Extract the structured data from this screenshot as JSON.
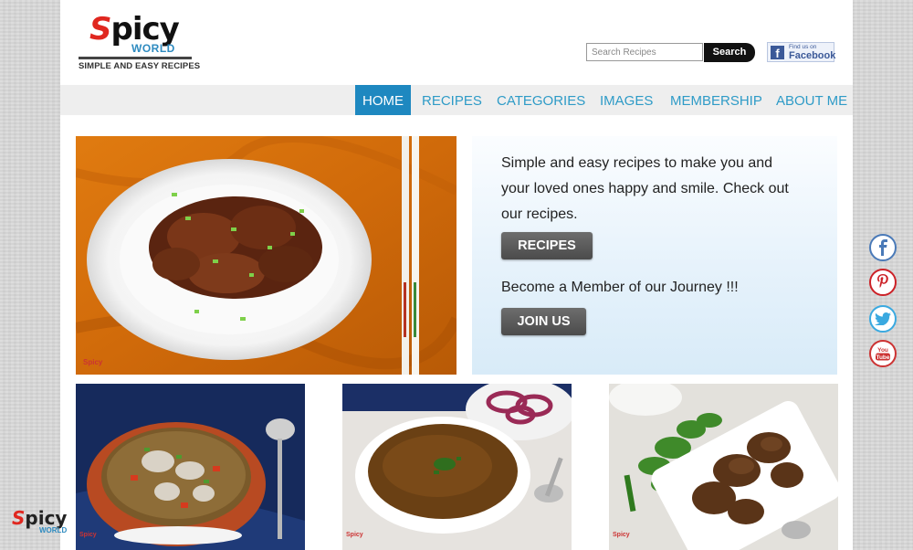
{
  "site": {
    "logo_text": "Spicy",
    "logo_sub": "WORLD",
    "tagline": "SIMPLE AND EASY RECIPES"
  },
  "search": {
    "placeholder": "Search Recipes",
    "button_label": "Search"
  },
  "facebook": {
    "small_text": "Find us on",
    "big_text": "Facebook"
  },
  "nav": {
    "items": [
      {
        "label": "HOME",
        "active": true
      },
      {
        "label": "RECIPES",
        "active": false
      },
      {
        "label": "CATEGORIES",
        "active": false
      },
      {
        "label": "IMAGES",
        "active": false
      },
      {
        "label": "MEMBERSHIP",
        "active": false
      },
      {
        "label": "ABOUT ME",
        "active": false
      }
    ]
  },
  "hero": {
    "intro": "Simple and easy recipes to make you and your loved ones happy and smile. Check out our recipes.",
    "recipes_button": "RECIPES",
    "member_text": "Become a Member of our Journey !!!",
    "join_button": "JOIN US"
  },
  "social": [
    {
      "icon": "facebook-icon",
      "color": "#4a7ab8"
    },
    {
      "icon": "pinterest-icon",
      "color": "#cc2127"
    },
    {
      "icon": "twitter-icon",
      "color": "#3aa9e0"
    },
    {
      "icon": "youtube-icon",
      "color": "#cc3333"
    }
  ],
  "colors": {
    "accent": "#1e88c0",
    "nav_text": "#2e9bc7",
    "brand_red": "#e0271f"
  }
}
